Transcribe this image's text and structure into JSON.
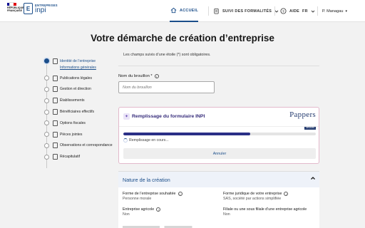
{
  "header": {
    "rf_flag_colors": [
      "#000091",
      "#ffffff",
      "#e1000f"
    ],
    "rf_text": "RÉPUBLIQUE\nFRANÇAISE",
    "brand_small": "ENTREPRISES",
    "brand_main": "inpi",
    "nav": {
      "home": "ACCUEIL",
      "tracking": "SUIVI DES FORMALITÉS",
      "help": "AIDE",
      "lang": "FR"
    },
    "user": "P. Managau"
  },
  "page_title": "Votre démarche de création d’entreprise",
  "stepper": {
    "steps": [
      {
        "label": "Identité de l’entreprise",
        "active": true
      },
      {
        "label": "Publications légales",
        "active": false
      },
      {
        "label": "Gestion et direction",
        "active": false
      },
      {
        "label": "Établissements",
        "active": false
      },
      {
        "label": "Bénéficiaires effectifs",
        "active": false
      },
      {
        "label": "Options fiscales",
        "active": false
      },
      {
        "label": "Pièces jointes",
        "active": false
      },
      {
        "label": "Observations et correspondance",
        "active": false
      },
      {
        "label": "Récapitulatif",
        "active": false
      }
    ],
    "sub_label": "Informations générales"
  },
  "form": {
    "required_note": "Les champs suivis d’une étoile (*) sont obligatoires.",
    "draft_label": "Nom du brouillon *",
    "draft_placeholder": "Nom du brouillon"
  },
  "fill_card": {
    "title": "Remplissage du formulaire INPI",
    "partner_brand": "Pappers",
    "partner_tag": "services",
    "progress": 0.66,
    "progress_text": "Remplissage en cours...",
    "cancel_label": "Annuler"
  },
  "nature": {
    "title": "Nature de la création",
    "fields": [
      {
        "key": "Forme de l’entreprise souhaitée",
        "value": "Personne morale"
      },
      {
        "key": "Forme juridique de votre entreprise",
        "value": "SAS, société par actions simplifiée"
      },
      {
        "key": "Entreprise agricole",
        "value": "Non"
      },
      {
        "key": "Filiale ou une sous filiale d’une entreprise agricole",
        "value": "Non"
      }
    ]
  },
  "colors": {
    "accent": "#1b4e8a",
    "progress": "#2a2f86",
    "card_border": "#e3b9cc"
  }
}
